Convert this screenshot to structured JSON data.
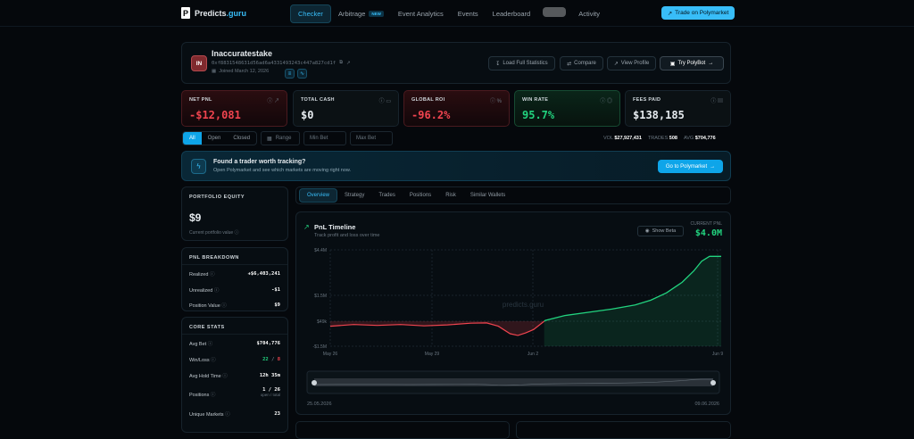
{
  "brand": {
    "name": "Predicts",
    "suffix": ".guru"
  },
  "nav": {
    "items": [
      {
        "label": "Checker",
        "active": true
      },
      {
        "label": "Arbitrage",
        "badge": "NEW"
      },
      {
        "label": "Event Analytics"
      },
      {
        "label": "Events"
      },
      {
        "label": "Leaderboard"
      },
      {
        "label": ""
      },
      {
        "label": "Activity"
      }
    ],
    "trade_button": "Trade on Polymarket"
  },
  "profile": {
    "initials": "IN",
    "name": "Inaccuratestake",
    "address": "0xf8831548631d56ad6a4331493243c447a827cd1f",
    "joined": "Joined March 12, 2026",
    "buttons": {
      "load": "Load Full Statistics",
      "compare": "Compare",
      "view": "View Profile",
      "polybot": "Try PolyBot"
    }
  },
  "stats": [
    {
      "label": "NET PNL",
      "value": "-$12,081",
      "tone": "red"
    },
    {
      "label": "TOTAL CASH",
      "value": "$0",
      "tone": "plain"
    },
    {
      "label": "GLOBAL ROI",
      "value": "-96.2%",
      "tone": "red"
    },
    {
      "label": "WIN RATE",
      "value": "95.7%",
      "tone": "green"
    },
    {
      "label": "FEES PAID",
      "value": "$138,185",
      "tone": "plain"
    }
  ],
  "filters": {
    "segments": [
      "All",
      "Open",
      "Closed"
    ],
    "range": "Range",
    "min_bet": "Min Bet",
    "max_bet": "Max Bet",
    "vol_label": "VOL",
    "vol": "$27,927,431",
    "trades_label": "TRADES",
    "trades": "508",
    "avg_label": "AVG",
    "avg": "$704,776"
  },
  "banner": {
    "title": "Found a trader worth tracking?",
    "subtitle": "Open Polymarket and see which markets are moving right now.",
    "button": "Go to Polymarket"
  },
  "equity": {
    "heading": "PORTFOLIO EQUITY",
    "value": "$9",
    "sub": "Current portfolio value"
  },
  "pnl_breakdown": {
    "heading": "PNL BREAKDOWN",
    "rows": [
      {
        "label": "Realized",
        "value": "+$6,403,241"
      },
      {
        "label": "Unrealized",
        "value": "-$1"
      },
      {
        "label": "Position Value",
        "value": "$9"
      }
    ]
  },
  "core_stats": {
    "heading": "CORE STATS",
    "rows": [
      {
        "label": "Avg Bet",
        "value": "$704,776"
      },
      {
        "label": "Win/Loss",
        "win": "22",
        "sep": "/",
        "loss": "8"
      },
      {
        "label": "Avg Hold Time",
        "value": "12h 35m"
      },
      {
        "label": "Positions",
        "value": "1 / 26",
        "sub": "open / total"
      },
      {
        "label": "Unique Markets",
        "value": "23"
      }
    ]
  },
  "tabs": [
    "Overview",
    "Strategy",
    "Trades",
    "Positions",
    "Risk",
    "Similar Wallets"
  ],
  "chart": {
    "title": "PnL Timeline",
    "subtitle": "Track profit and loss over time",
    "show_beta": "Show Beta",
    "current_label": "CURRENT PNL",
    "current_value": "$4.0M",
    "watermark": "predicts.guru",
    "range_start": "25.05.2026",
    "range_end": "09.06.2026"
  },
  "chart_data": {
    "type": "line",
    "x_ticks": [
      "May 26",
      "May 29",
      "Jun 2",
      "Jun 9"
    ],
    "y_ticks": [
      "$4.4M",
      "$1.5M",
      "$49k",
      "-$1.5M"
    ],
    "points": [
      [
        0,
        -0.3
      ],
      [
        0.06,
        -0.2
      ],
      [
        0.12,
        -0.25
      ],
      [
        0.18,
        -0.2
      ],
      [
        0.24,
        -0.28
      ],
      [
        0.3,
        -0.22
      ],
      [
        0.36,
        -0.12
      ],
      [
        0.4,
        -0.1
      ],
      [
        0.43,
        -0.3
      ],
      [
        0.46,
        -0.75
      ],
      [
        0.48,
        -0.85
      ],
      [
        0.5,
        -0.7
      ],
      [
        0.52,
        -0.5
      ],
      [
        0.55,
        0.05
      ],
      [
        0.6,
        0.35
      ],
      [
        0.66,
        0.55
      ],
      [
        0.72,
        0.75
      ],
      [
        0.78,
        1.0
      ],
      [
        0.82,
        1.3
      ],
      [
        0.86,
        1.75
      ],
      [
        0.9,
        2.4
      ],
      [
        0.93,
        3.1
      ],
      [
        0.95,
        3.7
      ],
      [
        0.97,
        4.0
      ],
      [
        1,
        4.0
      ]
    ]
  }
}
